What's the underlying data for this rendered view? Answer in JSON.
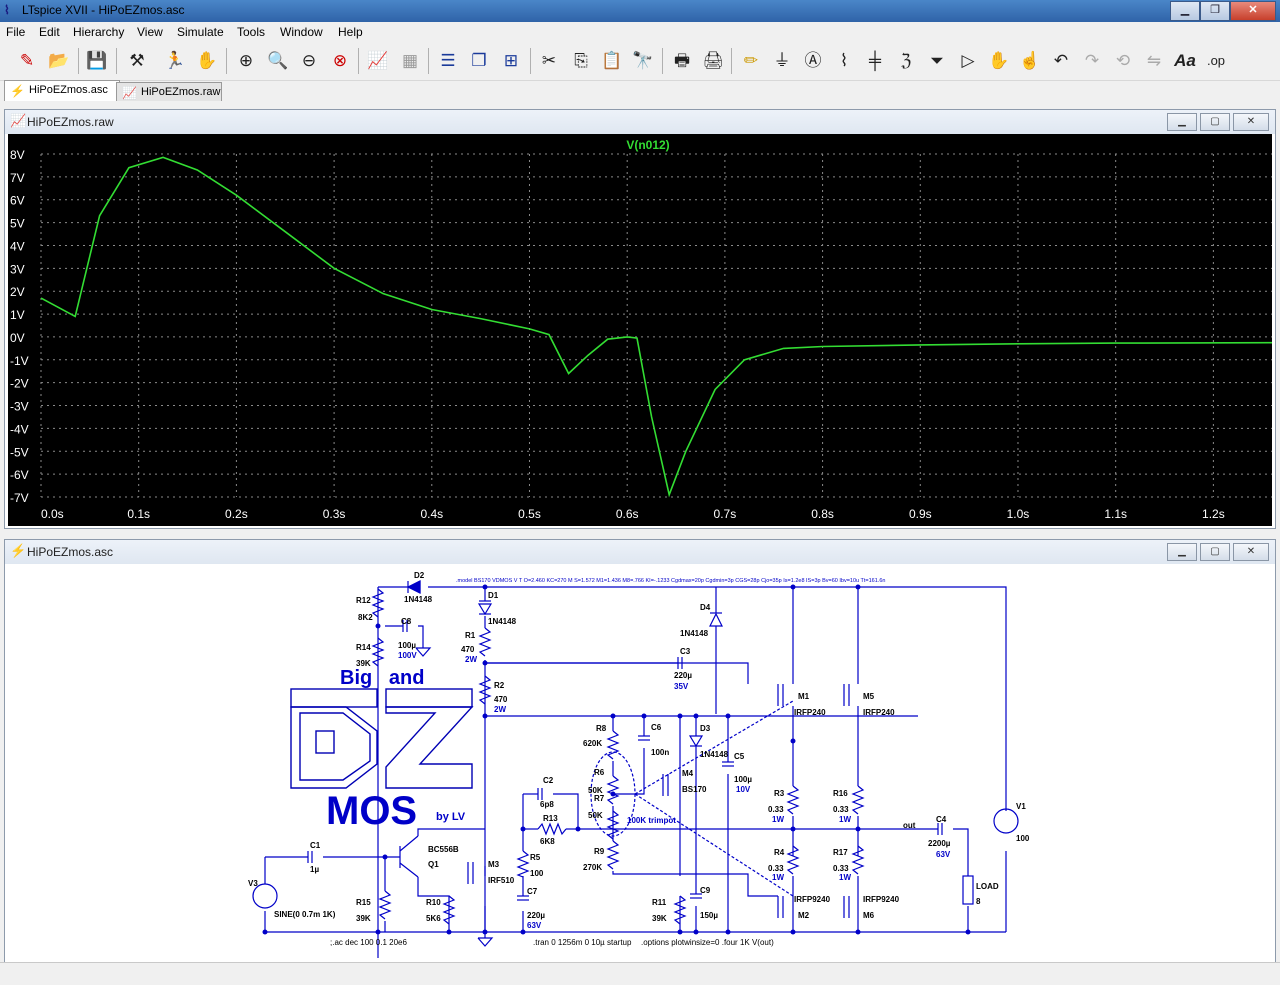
{
  "app": {
    "title": "LTspice XVII - HiPoEZmos.asc"
  },
  "menu": [
    "File",
    "Edit",
    "Hierarchy",
    "View",
    "Simulate",
    "Tools",
    "Window",
    "Help"
  ],
  "toolbar_icons": [
    "new-schematic-icon",
    "open-icon",
    "save-icon",
    "control-panel-icon",
    "run-icon",
    "halt-icon",
    "zoom-in-icon",
    "zoom-pan-icon",
    "zoom-out-icon",
    "zoom-cancel-icon",
    "autoscale-icon",
    "zoom-full-icon",
    "tile-horizontal-icon",
    "cascade-icon",
    "tile-vertical-icon",
    "cut-icon",
    "copy-icon",
    "paste-icon",
    "find-icon",
    "print-icon",
    "print-setup-icon",
    "draw-wire-icon",
    "ground-icon",
    "label-net-icon",
    "resistor-icon",
    "capacitor-icon",
    "inductor-icon",
    "diode-icon",
    "component-icon",
    "move-icon",
    "drag-icon",
    "undo-icon",
    "redo-icon",
    "rotate-icon",
    "mirror-icon",
    "text-icon",
    "spice-directive-icon"
  ],
  "tabs": [
    {
      "label": "HiPoEZmos.asc",
      "active": true
    },
    {
      "label": "HiPoEZmos.raw",
      "active": false
    }
  ],
  "waveform_window": {
    "title": "HiPoEZmos.raw",
    "trace_name": "V(n012)",
    "trace_color": "#33dd33",
    "y_ticks": [
      "8V",
      "7V",
      "6V",
      "5V",
      "4V",
      "3V",
      "2V",
      "1V",
      "0V",
      "-1V",
      "-2V",
      "-3V",
      "-4V",
      "-5V",
      "-6V",
      "-7V"
    ],
    "x_ticks": [
      "0.0s",
      "0.1s",
      "0.2s",
      "0.3s",
      "0.4s",
      "0.5s",
      "0.6s",
      "0.7s",
      "0.8s",
      "0.9s",
      "1.0s",
      "1.1s",
      "1.2s"
    ]
  },
  "schematic_window": {
    "title": "HiPoEZmos.asc",
    "model_directive": ".model BS170 VDMOS V T O=2.460 KC=270 M S=1.572 M1=1.436 M8=.766 KI=-.1233 Cgdmax=20p Cgdmin=3p CGS=28p Cjo=35p Is=1.2e8 IS=3p Bv=60 Ibv=10u Tt=161.6n",
    "directives": {
      "ac": ";.ac dec 100 0.1 20e6",
      "tran": ".tran 0 1256m 0 10µ startup",
      "options": ".options plotwinsize=0 .four 1K V(out)"
    },
    "logo": {
      "line1": "Big   and",
      "line2": "MOS",
      "byline": "by LV"
    },
    "components": {
      "D2": {
        "name": "D2",
        "value": "1N4148"
      },
      "D1": {
        "name": "D1",
        "value": "1N4148"
      },
      "D4": {
        "name": "D4",
        "value": "1N4148"
      },
      "D3": {
        "name": "D3",
        "value": "1N4148"
      },
      "R12": {
        "name": "R12",
        "value": "8K2"
      },
      "R14": {
        "name": "R14",
        "value": "39K"
      },
      "C8": {
        "name": "C8",
        "value": "100µ",
        "rating": "100V"
      },
      "R1": {
        "name": "R1",
        "value": "470",
        "rating": "2W"
      },
      "R2": {
        "name": "R2",
        "value": "470",
        "rating": "2W"
      },
      "C3": {
        "name": "C3",
        "value": "220µ",
        "rating": "35V"
      },
      "M1": {
        "name": "M1",
        "value": "IRFP240"
      },
      "M5": {
        "name": "M5",
        "value": "IRFP240"
      },
      "R8": {
        "name": "R8",
        "value": "620K"
      },
      "C6": {
        "name": "C6",
        "value": "100n"
      },
      "C5": {
        "name": "C5",
        "value": "100µ",
        "rating": "10V"
      },
      "M4": {
        "name": "M4",
        "value": "BS170"
      },
      "R6": {
        "name": "R6",
        "value": "50K"
      },
      "R7": {
        "name": "R7",
        "value": "50K"
      },
      "trimpot": "100K trimpot",
      "C2": {
        "name": "C2",
        "value": "6p8"
      },
      "R13": {
        "name": "R13",
        "value": "6K8"
      },
      "R3": {
        "name": "R3",
        "value": "0.33",
        "rating": "1W"
      },
      "R16": {
        "name": "R16",
        "value": "0.33",
        "rating": "1W"
      },
      "R4": {
        "name": "R4",
        "value": "0.33",
        "rating": "1W"
      },
      "R17": {
        "name": "R17",
        "value": "0.33",
        "rating": "1W"
      },
      "out_label": "out",
      "C4": {
        "name": "C4",
        "value": "2200µ",
        "rating": "63V"
      },
      "V1": {
        "name": "V1",
        "value": "100"
      },
      "C1": {
        "name": "C1",
        "value": "1µ"
      },
      "Q1": {
        "name": "Q1",
        "value": "BC556B"
      },
      "M3": {
        "name": "M3",
        "value": "IRF510"
      },
      "R5": {
        "name": "R5",
        "value": "100"
      },
      "R9": {
        "name": "R9",
        "value": "270K"
      },
      "C7": {
        "name": "C7",
        "value": "220µ",
        "rating": "63V"
      },
      "V3": {
        "name": "V3",
        "value": "SINE(0 0.7m 1K)"
      },
      "R15": {
        "name": "R15",
        "value": "39K"
      },
      "R10": {
        "name": "R10",
        "value": "5K6"
      },
      "R11": {
        "name": "R11",
        "value": "39K"
      },
      "C9": {
        "name": "C9",
        "value": "150µ"
      },
      "M2": {
        "name": "M2",
        "value": "IRFP9240"
      },
      "M6": {
        "name": "M6",
        "value": "IRFP9240"
      },
      "LOAD": {
        "name": "LOAD",
        "value": "8"
      }
    }
  }
}
